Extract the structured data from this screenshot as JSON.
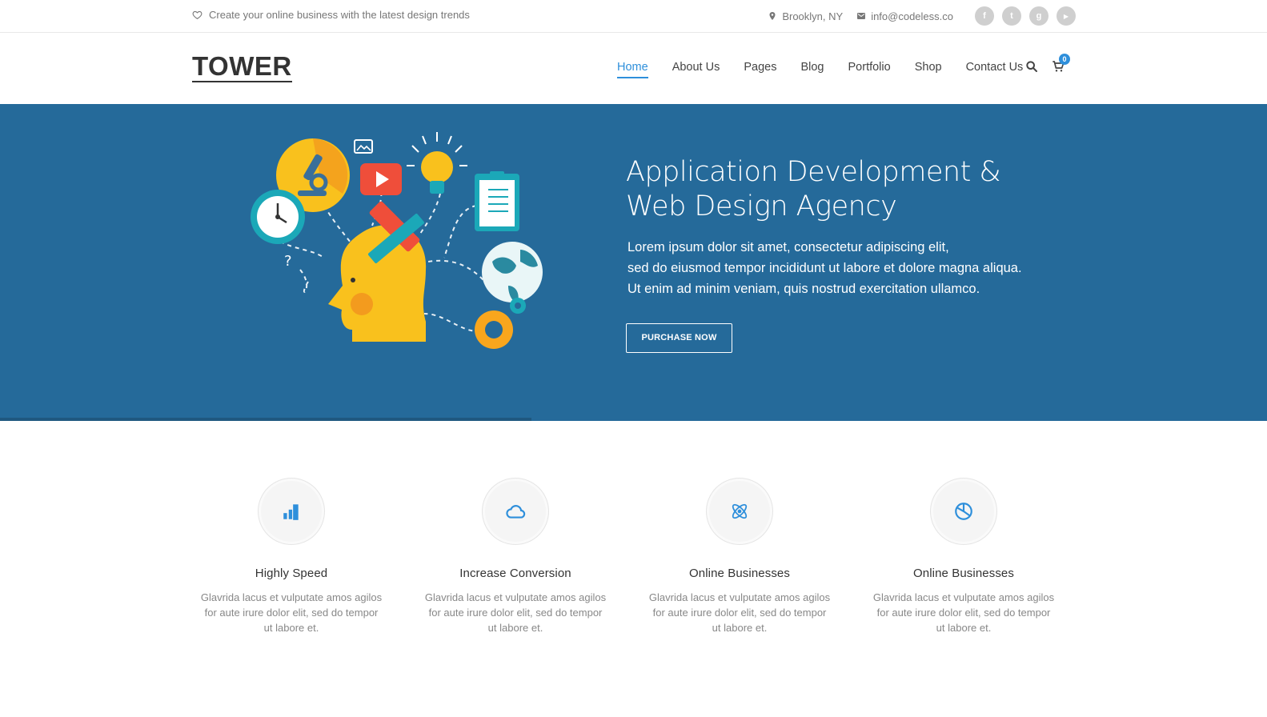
{
  "topbar": {
    "tagline": "Create your online business with the latest design trends",
    "location": "Brooklyn, NY",
    "email": "info@codeless.co",
    "social": [
      {
        "icon": "facebook-icon",
        "glyph": "f"
      },
      {
        "icon": "twitter-icon",
        "glyph": "t"
      },
      {
        "icon": "google-plus-icon",
        "glyph": "g"
      },
      {
        "icon": "youtube-icon",
        "glyph": "▶"
      }
    ]
  },
  "header": {
    "logo": "TOWER",
    "nav": [
      "Home",
      "About Us",
      "Pages",
      "Blog",
      "Portfolio",
      "Shop",
      "Contact Us"
    ],
    "active_nav": "Home",
    "cart_count": "0"
  },
  "hero": {
    "title_line1": "Application Development &",
    "title_line2": "Web Design Agency",
    "text_line1": "Lorem ipsum dolor sit amet, consectetur adipiscing elit,",
    "text_line2": "sed do eiusmod tempor incididunt ut labore et dolore magna aliqua.",
    "text_line3": "Ut enim ad minim veniam, quis nostrud exercitation ullamco.",
    "button": "PURCHASE NOW",
    "background_color": "#256a9a"
  },
  "features": [
    {
      "icon": "bar-chart-icon",
      "title": "Highly Speed",
      "text": "Glavrida lacus et vulputate amos agilos for aute irure dolor elit, sed do tempor ut labore et."
    },
    {
      "icon": "cloud-icon",
      "title": "Increase Conversion",
      "text": "Glavrida lacus et vulputate amos agilos for aute irure dolor elit, sed do tempor ut labore et."
    },
    {
      "icon": "atom-icon",
      "title": "Online Businesses",
      "text": "Glavrida lacus et vulputate amos agilos for aute irure dolor elit, sed do tempor ut labore et."
    },
    {
      "icon": "pie-chart-icon",
      "title": "Online Businesses",
      "text": "Glavrida lacus et vulputate amos agilos for aute irure dolor elit, sed do tempor ut labore et."
    }
  ],
  "colors": {
    "accent": "#2e8fdb",
    "hero": "#256a9a"
  }
}
